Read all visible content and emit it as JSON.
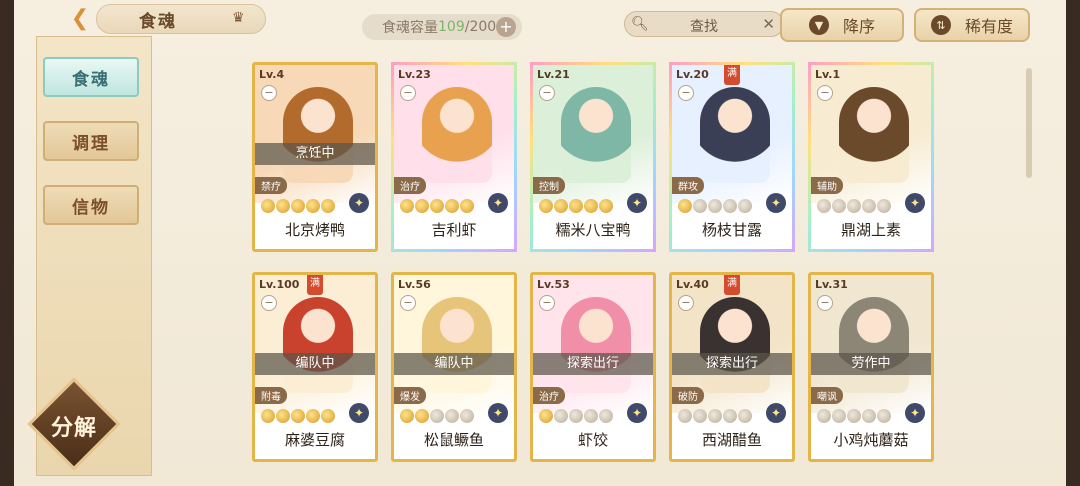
{
  "header": {
    "title": "食魂",
    "capacity_label": "食魂容量",
    "capacity_used": "109",
    "capacity_total": "/200",
    "search_label": "查找",
    "sort_desc_label": "降序",
    "sort_rarity_label": "稀有度"
  },
  "sidebar": {
    "tabs": [
      {
        "label": "食魂"
      },
      {
        "label": "调理"
      },
      {
        "label": "信物"
      }
    ],
    "decompose_label": "分解"
  },
  "cards": [
    {
      "level": "Lv.4",
      "status": "烹饪中",
      "role": "禁疗",
      "name": "北京烤鸭",
      "full": false,
      "gold_pips": 5
    },
    {
      "level": "Lv.23",
      "status": "",
      "role": "治疗",
      "name": "吉利虾",
      "full": false,
      "gold_pips": 5
    },
    {
      "level": "Lv.21",
      "status": "",
      "role": "控制",
      "name": "糯米八宝鸭",
      "full": false,
      "gold_pips": 5
    },
    {
      "level": "Lv.20",
      "status": "",
      "role": "群攻",
      "name": "杨枝甘露",
      "full": true,
      "gold_pips": 1
    },
    {
      "level": "Lv.1",
      "status": "",
      "role": "辅助",
      "name": "鼎湖上素",
      "full": false,
      "gold_pips": 0
    },
    {
      "level": "Lv.100",
      "status": "编队中",
      "role": "附毒",
      "name": "麻婆豆腐",
      "full": true,
      "gold_pips": 5
    },
    {
      "level": "Lv.56",
      "status": "编队中",
      "role": "爆发",
      "name": "松鼠鳜鱼",
      "full": false,
      "gold_pips": 2
    },
    {
      "level": "Lv.53",
      "status": "探索出行",
      "role": "治疗",
      "name": "虾饺",
      "full": false,
      "gold_pips": 1
    },
    {
      "level": "Lv.40",
      "status": "探索出行",
      "role": "破防",
      "name": "西湖醋鱼",
      "full": true,
      "gold_pips": 0
    },
    {
      "level": "Lv.31",
      "status": "劳作中",
      "role": "嘲讽",
      "name": "小鸡炖蘑菇",
      "full": false,
      "gold_pips": 0
    }
  ],
  "full_badge_text": "满",
  "icons": {
    "back": "back-arrow-icon",
    "crown": "crown-icon",
    "search": "search-icon",
    "clear": "close-icon",
    "sort": "sort-down-icon",
    "rarity": "rarity-icon",
    "minus": "minus-icon",
    "star": "star-icon"
  },
  "colors": {
    "accent_gold": "#e4b64a",
    "active_tab": "#bfe6df",
    "capacity_used": "#7ab56a"
  }
}
